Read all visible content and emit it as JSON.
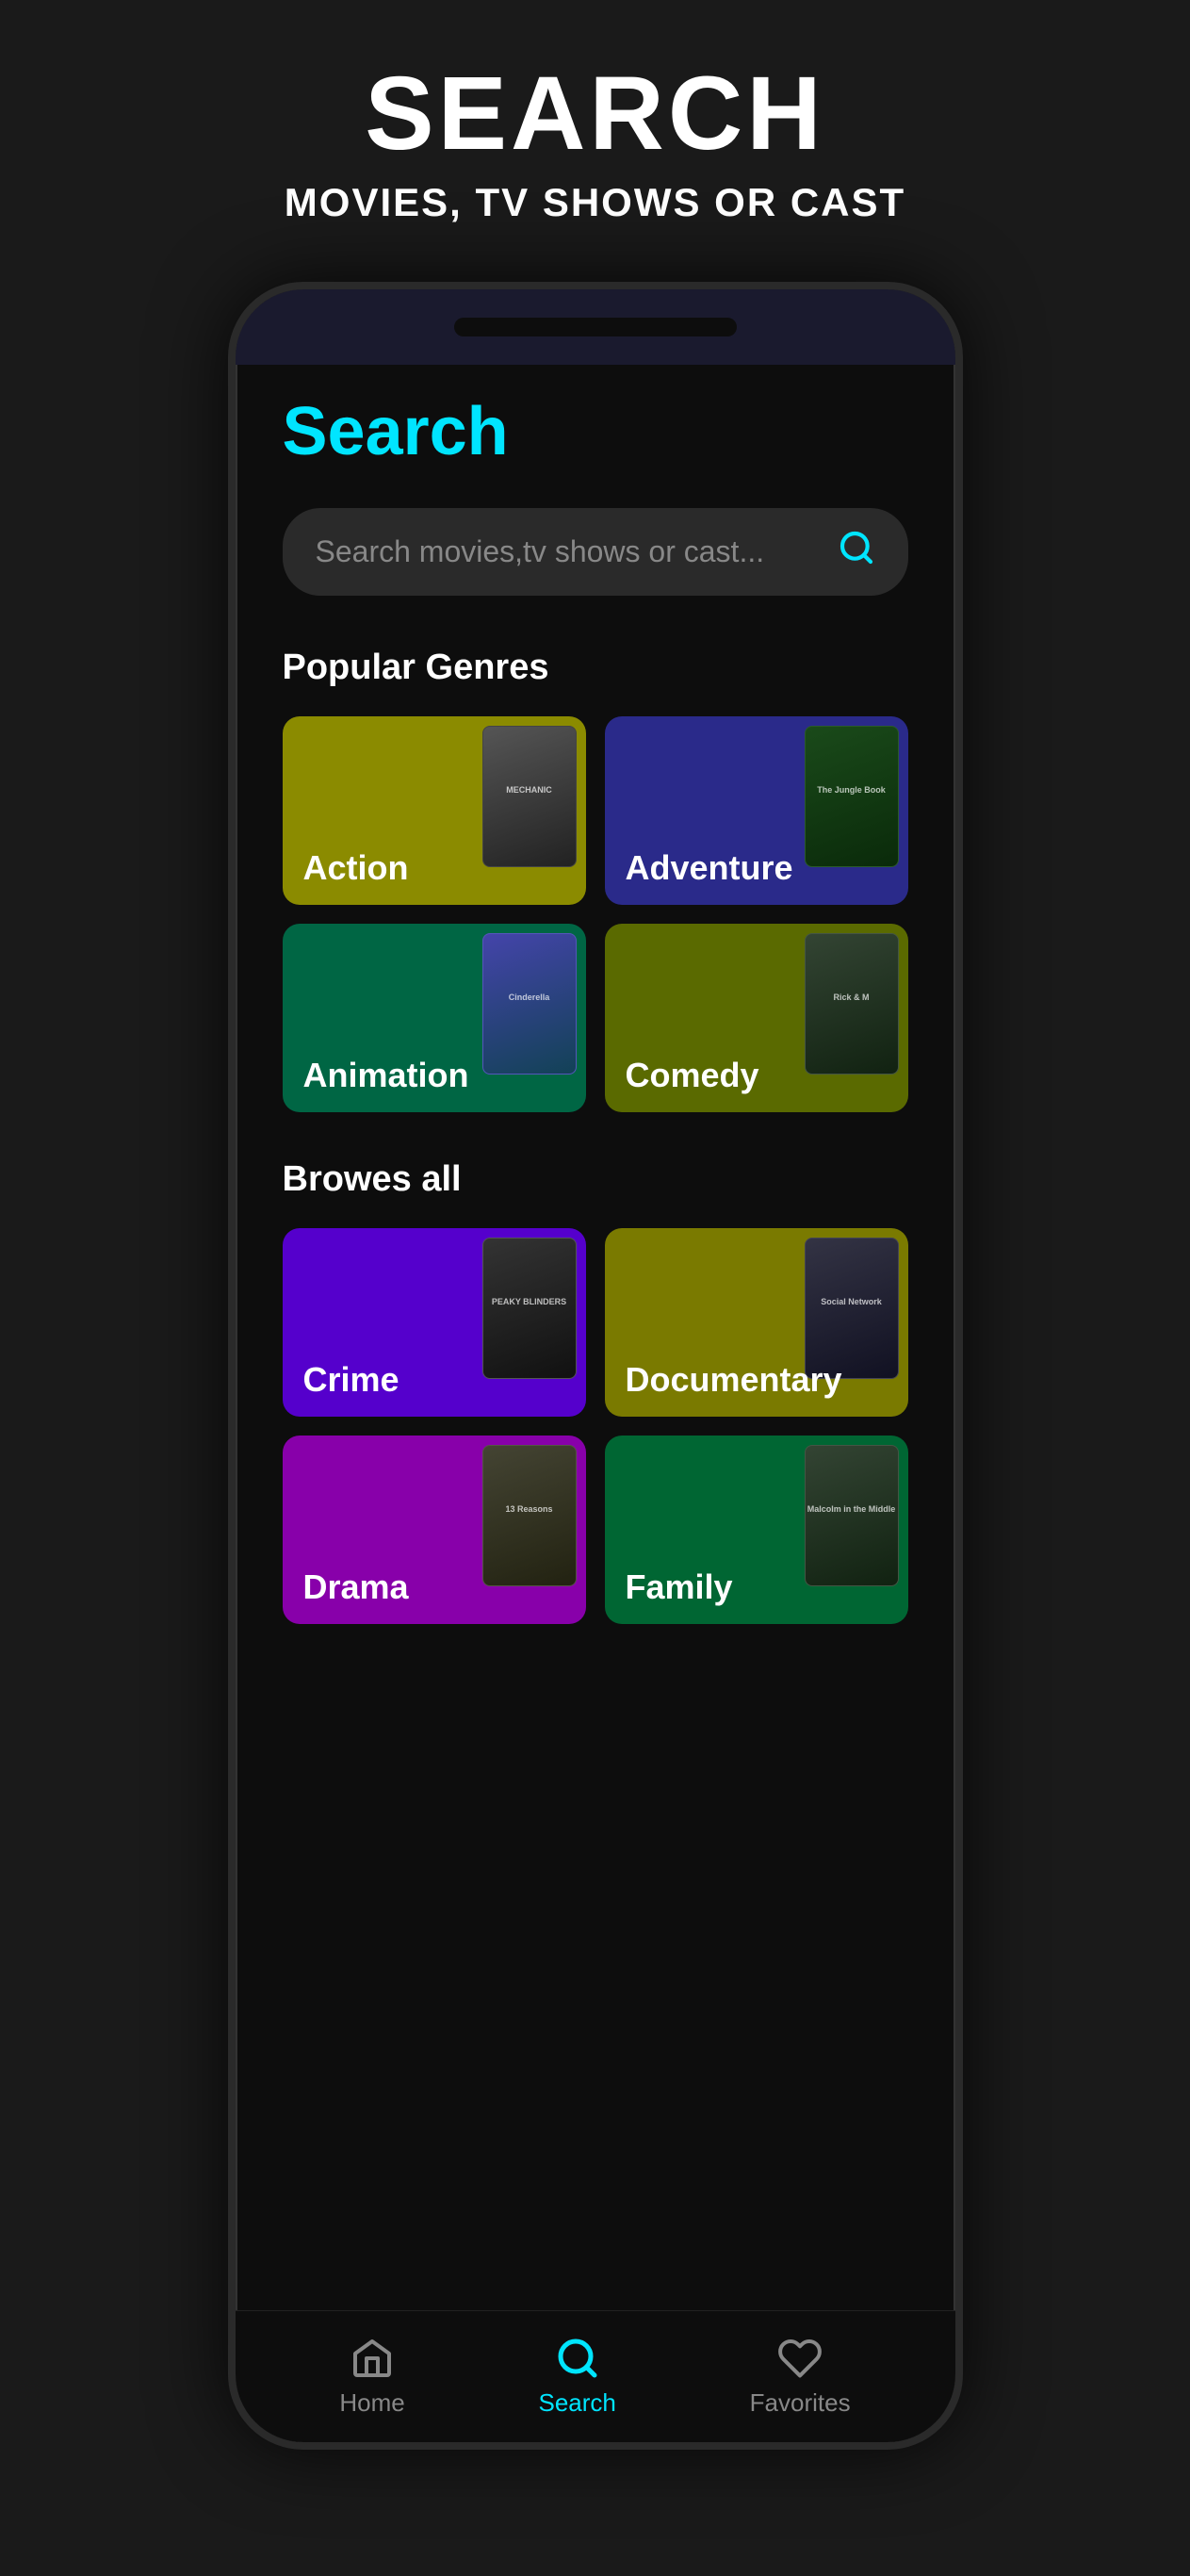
{
  "header": {
    "title": "SEARCH",
    "subtitle": "MOVIES, TV SHOWS OR CAST"
  },
  "phone": {
    "page_title": "Search",
    "search": {
      "placeholder": "Search movies,tv shows or cast...",
      "icon": "search-icon"
    },
    "sections": [
      {
        "id": "popular",
        "title": "Popular Genres",
        "genres": [
          {
            "id": "action",
            "label": "Action",
            "color": "#8B8B00",
            "poster": "MECHANIC"
          },
          {
            "id": "adventure",
            "label": "Adventure",
            "color": "#2a2a8a",
            "poster": "The Jungle Book"
          },
          {
            "id": "animation",
            "label": "Animation",
            "color": "#006644",
            "poster": "Cinderella"
          },
          {
            "id": "comedy",
            "label": "Comedy",
            "color": "#5a6a00",
            "poster": "Rick & M"
          }
        ]
      },
      {
        "id": "browse",
        "title": "Browes all",
        "genres": [
          {
            "id": "crime",
            "label": "Crime",
            "color": "#5500cc",
            "poster": "PEAKY BLINDERS"
          },
          {
            "id": "documentary",
            "label": "Documentary",
            "color": "#7a7a00",
            "poster": "The Social Network"
          },
          {
            "id": "drama",
            "label": "Drama",
            "color": "#8800aa",
            "poster": "13 Reasons Why"
          },
          {
            "id": "family",
            "label": "Family",
            "color": "#006633",
            "poster": "Malcolm in the Middle"
          }
        ]
      }
    ],
    "nav": {
      "items": [
        {
          "id": "home",
          "label": "Home",
          "active": false
        },
        {
          "id": "search",
          "label": "Search",
          "active": true
        },
        {
          "id": "favorites",
          "label": "Favorites",
          "active": false
        }
      ]
    }
  }
}
